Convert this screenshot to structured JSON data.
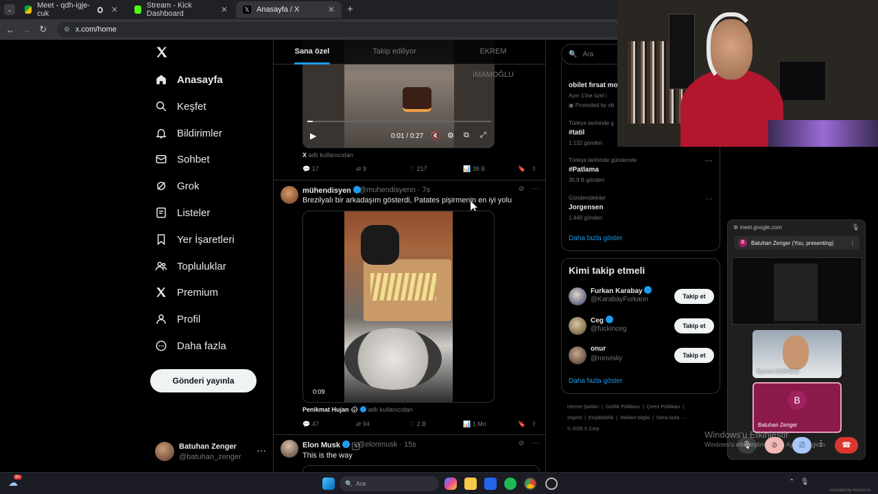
{
  "browser": {
    "tabs": [
      {
        "title": "Meet - qdh-igje-cuk",
        "favicon": "google-meet-icon"
      },
      {
        "title": "Stream - Kick Dashboard",
        "favicon": "kick-icon"
      },
      {
        "title": "Anasayfa / X",
        "favicon": "x-icon"
      }
    ],
    "url": "x.com/home"
  },
  "sidebar": {
    "items": [
      {
        "label": "Anasayfa",
        "icon": "home-icon"
      },
      {
        "label": "Keşfet",
        "icon": "search-icon"
      },
      {
        "label": "Bildirimler",
        "icon": "bell-icon"
      },
      {
        "label": "Sohbet",
        "icon": "mail-icon"
      },
      {
        "label": "Grok",
        "icon": "grok-icon"
      },
      {
        "label": "Listeler",
        "icon": "list-icon"
      },
      {
        "label": "Yer İşaretleri",
        "icon": "bookmark-icon"
      },
      {
        "label": "Topluluklar",
        "icon": "people-icon"
      },
      {
        "label": "Premium",
        "icon": "x-icon"
      },
      {
        "label": "Profil",
        "icon": "person-icon"
      },
      {
        "label": "Daha fazla",
        "icon": "more-circle-icon"
      }
    ],
    "post_button": "Gönderi yayınla",
    "account": {
      "name": "Batuhan Zenger",
      "handle": "@batuhan_zenger",
      "more": "···"
    }
  },
  "timeline": {
    "tabs": [
      "Sana özel",
      "Takip ediliyor",
      "EKREM İMAMOĞLU"
    ],
    "tweet1": {
      "video_time": "0:01 / 0:27",
      "attribution_bold": "X",
      "attribution": "adlı kullanıcıdan",
      "replies": "17",
      "reposts": "9",
      "likes": "217",
      "views": "38 B"
    },
    "tweet2": {
      "name": "mühendisyen",
      "handle": "@muhendisyenn · 7s",
      "text": "Brezilyalı bir arkadaşım gösterdi, Patates pişirmenin en iyi yolu",
      "video_time": "0:09",
      "attribution_name": "Penikmat Hujan 🌧",
      "attribution": "adlı kullanıcıdan",
      "replies": "47",
      "reposts": "94",
      "likes": "2 B",
      "views": "1 Mn"
    },
    "tweet3": {
      "name": "Elon Musk",
      "handle": "@elonmusk · 15s",
      "text": "This is the way"
    }
  },
  "right": {
    "search_placeholder": "Ara",
    "trends": [
      {
        "context": "",
        "title": "obilet fırsat mo",
        "count": "Ayın 1'ine özel i",
        "promoted": "Promoted by ob"
      },
      {
        "context": "Türkiye tarihinde g",
        "title": "#tatil",
        "count": "1.132 gönderi"
      },
      {
        "context": "Türkiye tarihinde gündemde",
        "title": "#Patlama",
        "count": "30,9 B gönderi"
      },
      {
        "context": "Gündemdekiler",
        "title": "Jorgensen",
        "count": "1.449 gönderi"
      }
    ],
    "show_more": "Daha fazla göster",
    "who_to_follow_title": "Kimi takip etmeli",
    "follow": [
      {
        "name": "Furkan Karabay",
        "handle": "@KarabayFurkann",
        "button": "Takip et"
      },
      {
        "name": "Ceg",
        "handle": "@fuckinceg",
        "button": "Takip et"
      },
      {
        "name": "onur",
        "handle": "@ronvisliy",
        "button": "Takip et"
      }
    ],
    "show_more2": "Daha fazla göster",
    "footer": [
      "Hizmet Şartları",
      "Gizlilik Politikası",
      "Çerez Politikası",
      "Imprint",
      "Erişilebilirlik",
      "Reklam bilgisi",
      "Daha fazla ···",
      "© 2026 X Corp."
    ]
  },
  "meet": {
    "url": "meet.google.com",
    "presenter": "Batuhan Zenger (You, presenting)",
    "tile1": "Eymen AÇIKGÖZ",
    "tile2_initial": "B",
    "tile2": "Batuhan Zenger"
  },
  "windows": {
    "watermark1": "Windows'u Etkinleştir",
    "watermark2": "Windows'u etkinleştirmek için Ayarlar'a gidin",
    "search": "Ara",
    "badge": "9+",
    "recorded": "recorded by movavi.io"
  },
  "colors": {
    "accent": "#1d9bf0",
    "background": "#000000",
    "border": "#2f3336",
    "meet_tile": "#8b1a4a"
  }
}
